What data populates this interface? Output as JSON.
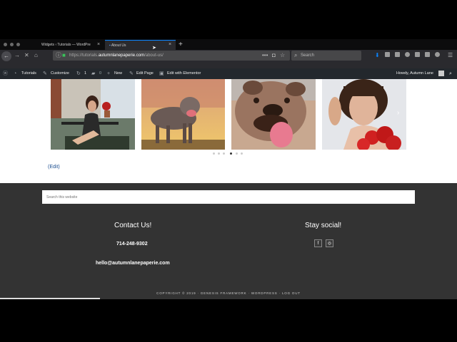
{
  "browser": {
    "tabs": [
      {
        "label": "Widgets ‹ Tutorials — WordPre"
      },
      {
        "label": "About Us"
      }
    ],
    "url_prefix": "https://tutorials.",
    "url_domain": "autumnlanepaperie.com",
    "url_path": "/about-us/",
    "search_placeholder": "Search",
    "close_glyph": "×",
    "newtab_glyph": "+"
  },
  "adminbar": {
    "site_name": "Tutorials",
    "customize": "Customize",
    "updates_count": "1",
    "comments_count": "0",
    "new_label": "New",
    "edit_page": "Edit Page",
    "elementor": "Edit with Elementor",
    "howdy": "Howdy, Autumn Lane"
  },
  "page": {
    "edit_link": "(Edit)",
    "carousel": {
      "slides": 6,
      "active_index": 3
    }
  },
  "footer": {
    "search_placeholder": "Search this website",
    "contact_heading": "Contact Us!",
    "phone": "714-248-9302",
    "email": "hello@autumnlanepaperie.com",
    "social_heading": "Stay social!",
    "facebook_glyph": "f",
    "instagram_glyph": "◎",
    "copyright": "COPYRIGHT © 2019 · GENESIS FRAMEWORK · WORDPRESS · LOG OUT"
  },
  "colors": {
    "accent_blue": "#0a84ff",
    "footer_bg": "#333333",
    "wp_bar": "#23282d"
  }
}
